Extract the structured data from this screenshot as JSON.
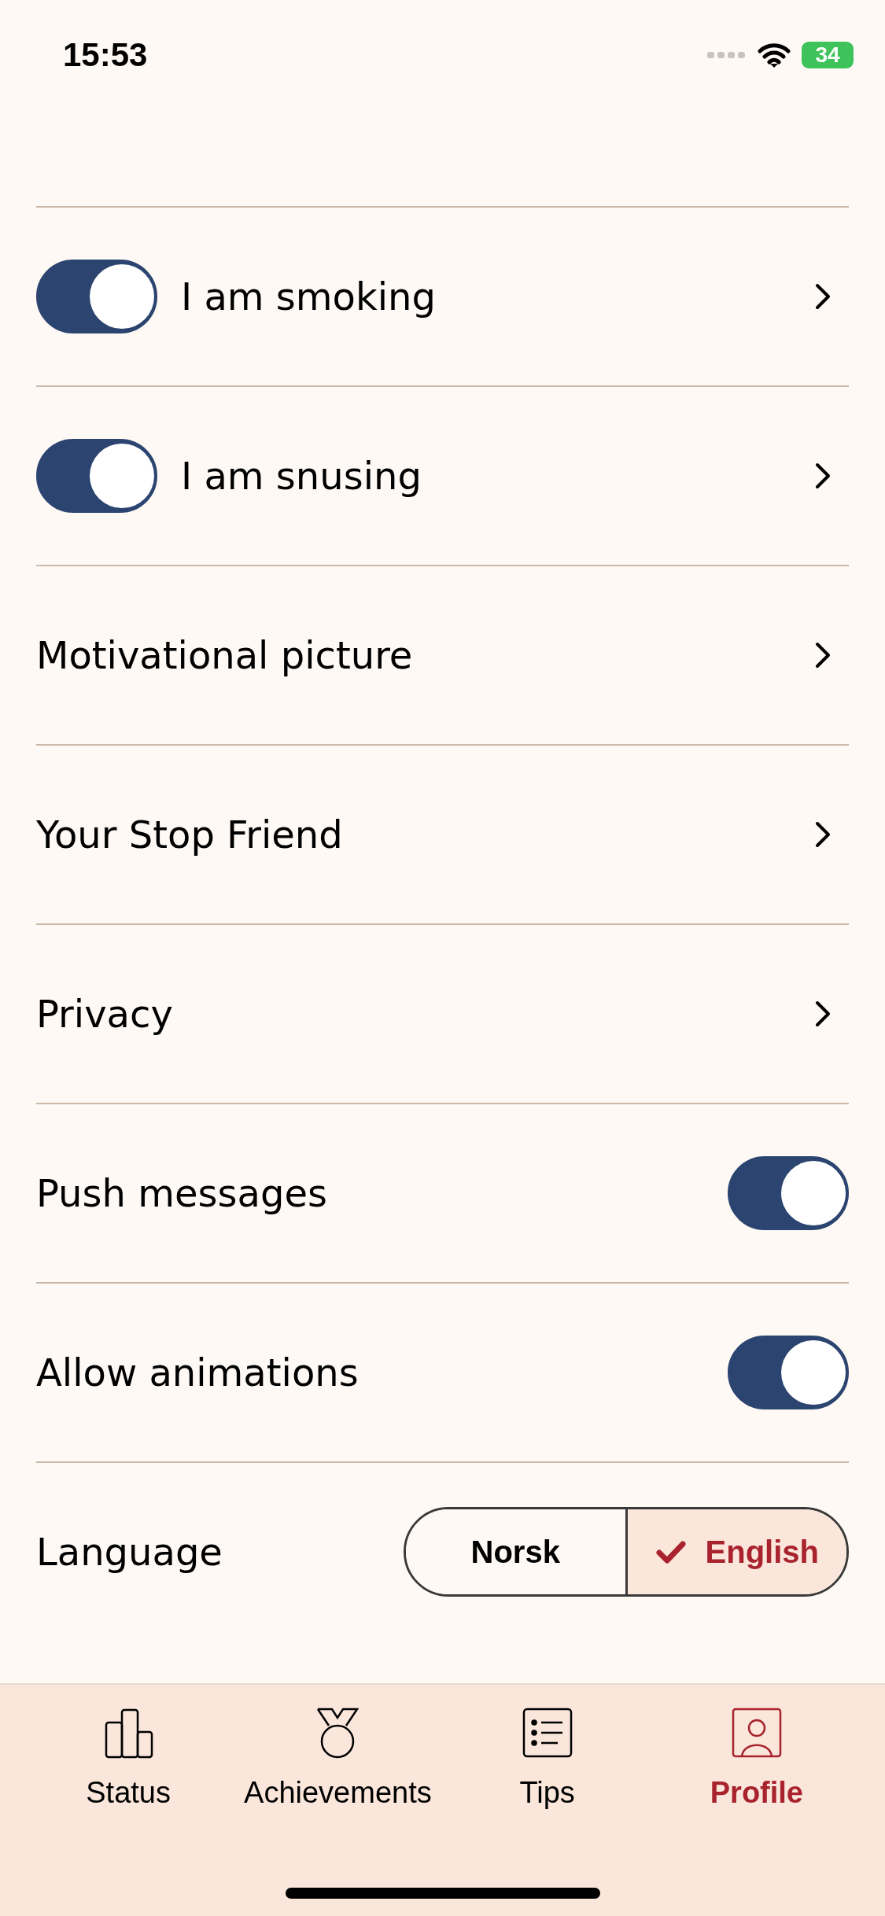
{
  "status_bar": {
    "time": "15:53",
    "battery": "34"
  },
  "rows": [
    {
      "kind": "toggle_link",
      "label": "I am smoking",
      "on": true
    },
    {
      "kind": "toggle_link",
      "label": "I am snusing",
      "on": true
    },
    {
      "kind": "link",
      "label": "Motivational picture"
    },
    {
      "kind": "link",
      "label": "Your Stop Friend"
    },
    {
      "kind": "link",
      "label": "Privacy"
    },
    {
      "kind": "toggle",
      "label": "Push messages",
      "on": true
    },
    {
      "kind": "toggle",
      "label": "Allow animations",
      "on": true
    },
    {
      "kind": "language",
      "label": "Language",
      "options": [
        {
          "label": "Norsk",
          "selected": false
        },
        {
          "label": "English",
          "selected": true
        }
      ]
    }
  ],
  "tabs": [
    {
      "kind": "chart",
      "label": "Status",
      "selected": false
    },
    {
      "kind": "medal",
      "label": "Achievements",
      "selected": false
    },
    {
      "kind": "list",
      "label": "Tips",
      "selected": false
    },
    {
      "kind": "person",
      "label": "Profile",
      "selected": true
    }
  ]
}
